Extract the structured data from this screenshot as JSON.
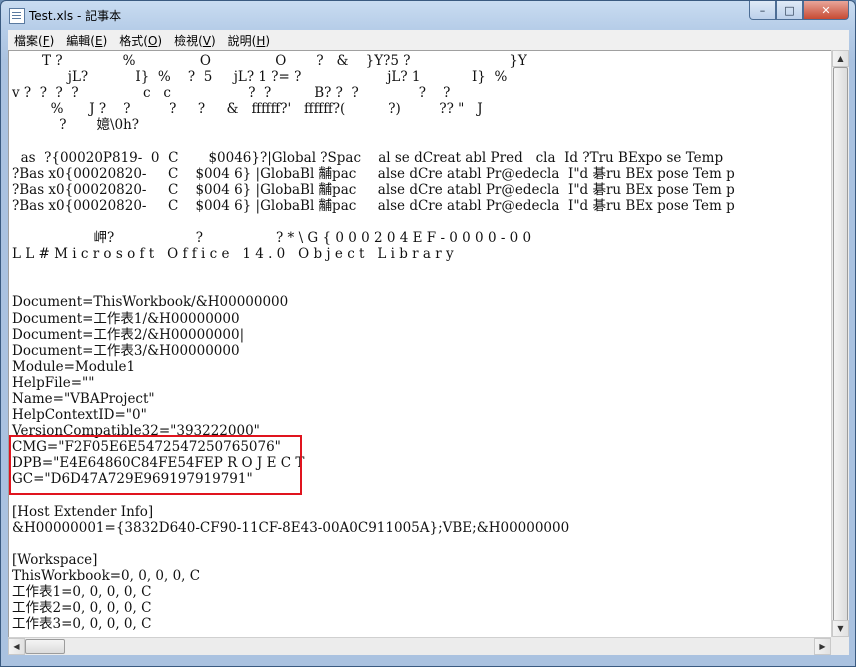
{
  "window": {
    "title": "Test.xls - 記事本"
  },
  "caption_buttons": {
    "minimize": "–",
    "maximize": "□",
    "close": "✕"
  },
  "menu": [
    {
      "label": "檔案(",
      "key": "F",
      "end": ")"
    },
    {
      "label": "編輯(",
      "key": "E",
      "end": ")"
    },
    {
      "label": "格式(",
      "key": "O",
      "end": ")"
    },
    {
      "label": "檢視(",
      "key": "V",
      "end": ")"
    },
    {
      "label": "說明(",
      "key": "H",
      "end": ")"
    }
  ],
  "scroll": {
    "up": "▲",
    "down": "▼",
    "left": "◀",
    "right": "▶"
  },
  "content": {
    "lines": [
      "       T ?              %               O               O       ?   &    }Y?5 ?                       }Y",
      "             jL?           I}  %    ?  5     jL? 1 ?= ?                    jL? 1            I}  %",
      "v ?  ?  ?  ?               c   c                  ?  ?          B? ?  ?              ?    ?",
      "         %      J ?    ?         ?     ?     &   ffffff?'   ffffff?(          ?)         ?? \"   J",
      "           ?       嬑\\0h?",
      "",
      "  as  ?{00020P819-  0  C       $0046}?|Global ?Spac    al se dCreat abl Pred   cla  Id ?Tru BExpo se Temp",
      "?Bas x0{00020820-     C    $004 6} |GlobaBl 黼pac     alse dCre atabl Pr@edecla  I\"d 碁ru BEx pose Tem p",
      "?Bas x0{00020820-     C    $004 6} |GlobaBl 黼pac     alse dCre atabl Pr@edecla  I\"d 碁ru BEx pose Tem p",
      "?Bas x0{00020820-     C    $004 6} |GlobaBl 黼pac     alse dCre atabl Pr@edecla  I\"d 碁ru BEx pose Tem p",
      "",
      "                   岬?                   ?                 ? * \\ G { 0 0 0 2 0 4 E F - 0 0 0 0 - 0 0",
      "L L # M i c r o s o f t   O f f i c e   1 4 . 0   O b j e c t   L i b r a r y",
      "",
      "",
      "Document=ThisWorkbook/&H00000000",
      "Document=工作表1/&H00000000",
      "Document=工作表2/&H00000000|",
      "Document=工作表3/&H00000000",
      "Module=Module1",
      "HelpFile=\"\"",
      "Name=\"VBAProject\"",
      "HelpContextID=\"0\"",
      "VersionCompatible32=\"393222000\"",
      "CMG=\"F2F05E6E5472547250765076\"",
      "DPB=\"E4E64860C84FE54FEP R O J E C T",
      "GC=\"D6D47A729E969197919791\"",
      "",
      "[Host Extender Info]",
      "&H00000001={3832D640-CF90-11CF-8E43-00A0C911005A};VBE;&H00000000",
      "",
      "[Workspace]",
      "ThisWorkbook=0, 0, 0, 0, C",
      "工作表1=0, 0, 0, 0, C",
      "工作表2=0, 0, 0, 0, C",
      "工作表3=0, 0, 0, 0, C"
    ]
  },
  "highlight_color": "#e0141e"
}
